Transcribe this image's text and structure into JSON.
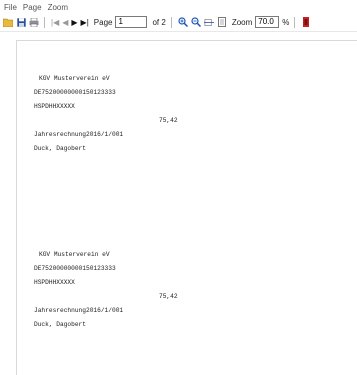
{
  "menu": {
    "items": [
      "File",
      "Page",
      "Zoom"
    ]
  },
  "toolbar": {
    "page_label": "Page",
    "page_value": "1",
    "page_of": "of 2",
    "zoom_label": "Zoom",
    "zoom_value": "70.0",
    "zoom_unit": "%",
    "icons": {
      "open": "folder-icon",
      "save": "save-icon",
      "print": "print-icon",
      "first": "first-page-icon",
      "prev": "prev-page-icon",
      "next": "next-page-icon",
      "last": "last-page-icon",
      "zoom_in": "zoom-in-icon",
      "zoom_out": "zoom-out-icon",
      "fit_width": "fit-width-icon",
      "fit_page": "fit-page-icon",
      "close": "close-icon"
    }
  },
  "report": {
    "blocks": [
      {
        "club": "KGV Musterverein eV",
        "iban": "DE75200000000150123333",
        "bic": "HSPDHHXXXXX",
        "amount": "75,42",
        "reference": "Jahresrechnung2016/1/001",
        "name": "Duck, Dagobert"
      },
      {
        "club": "KGV Musterverein eV",
        "iban": "DE75200000000150123333",
        "bic": "HSPDHHXXXXX",
        "amount": "75,42",
        "reference": "Jahresrechnung2016/1/001",
        "name": "Duck, Dagobert"
      }
    ]
  }
}
